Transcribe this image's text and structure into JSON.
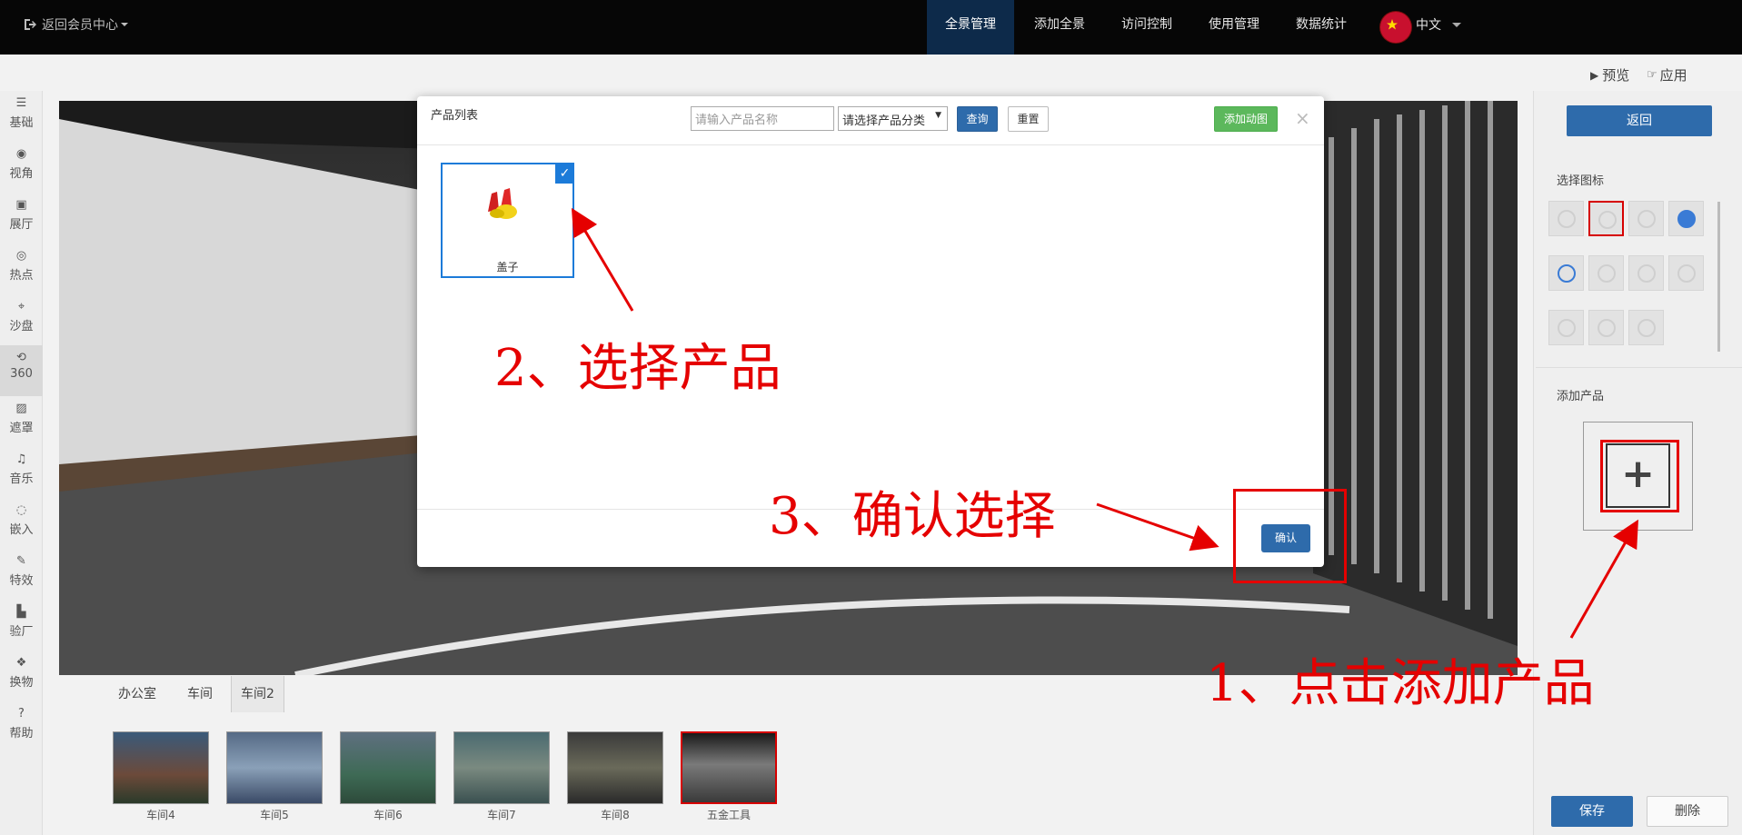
{
  "topbar": {
    "back_label": "返回会员中心",
    "nav": [
      "全景管理",
      "添加全景",
      "访问控制",
      "使用管理",
      "数据统计"
    ],
    "lang": "中文"
  },
  "sidebar": {
    "items": [
      "基础",
      "视角",
      "展厅",
      "热点",
      "沙盘",
      "360",
      "遮罩",
      "音乐",
      "嵌入",
      "特效",
      "验厂",
      "换物",
      "帮助"
    ]
  },
  "toolbar": {
    "preview": "预览",
    "apply": "应用"
  },
  "scenes": {
    "groups": [
      "办公室",
      "车间",
      "车间2"
    ],
    "thumbs": [
      "车间4",
      "车间5",
      "车间6",
      "车间7",
      "车间8",
      "五金工具"
    ]
  },
  "right_panel": {
    "back": "返回",
    "select_icon_title": "选择图标",
    "add_product_title": "添加产品",
    "plus": "+",
    "save": "保存",
    "delete": "删除"
  },
  "modal": {
    "title": "产品列表",
    "search_placeholder": "请输入产品名称",
    "category_select": "请选择产品分类",
    "query": "查询",
    "reset": "重置",
    "add_animation": "添加动图",
    "close": "×",
    "product_name": "盖子",
    "confirm": "确认"
  },
  "annotations": {
    "step1": "1、点击添加产品",
    "step2": "2、选择产品",
    "step3": "3、确认选择"
  },
  "colors": {
    "annotation": "#e50000",
    "primary": "#2e6bab",
    "green": "#5cb85c",
    "nav_active": "#0d2a4a"
  }
}
